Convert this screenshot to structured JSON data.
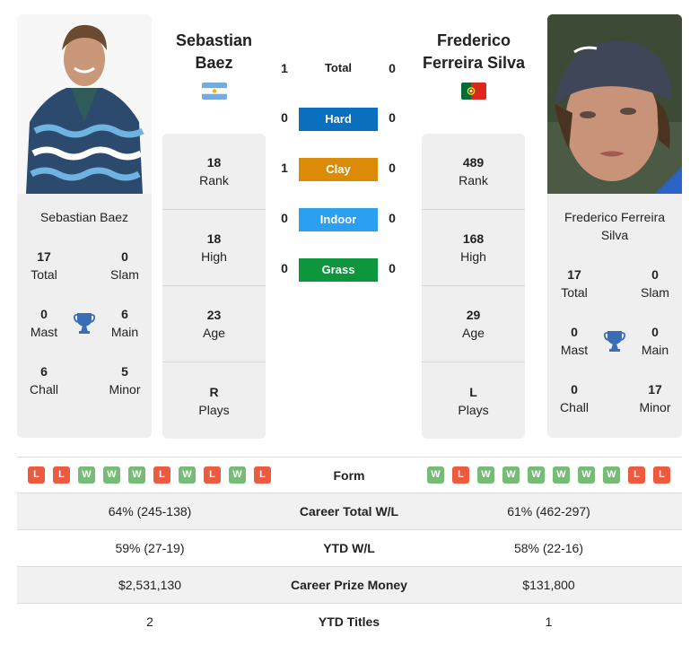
{
  "player1": {
    "name": "Sebastian Baez",
    "name_line1": "Sebastian",
    "name_line2": "Baez",
    "country": "Argentina",
    "flag_icon": "argentina-flag-icon",
    "titles": {
      "total": {
        "value": "17",
        "label": "Total"
      },
      "slam": {
        "value": "0",
        "label": "Slam"
      },
      "mast": {
        "value": "0",
        "label": "Mast"
      },
      "main": {
        "value": "6",
        "label": "Main"
      },
      "chall": {
        "value": "6",
        "label": "Chall"
      },
      "minor": {
        "value": "5",
        "label": "Minor"
      }
    },
    "stats": [
      {
        "value": "18",
        "label": "Rank"
      },
      {
        "value": "18",
        "label": "High"
      },
      {
        "value": "23",
        "label": "Age"
      },
      {
        "value": "R",
        "label": "Plays"
      }
    ],
    "form": [
      "L",
      "L",
      "W",
      "W",
      "W",
      "L",
      "W",
      "L",
      "W",
      "L"
    ]
  },
  "player2": {
    "name": "Frederico Ferreira Silva",
    "name_line1": "Frederico",
    "name_line2": "Ferreira Silva",
    "card_name_line1": "Frederico Ferreira",
    "card_name_line2": "Silva",
    "country": "Portugal",
    "flag_icon": "portugal-flag-icon",
    "titles": {
      "total": {
        "value": "17",
        "label": "Total"
      },
      "slam": {
        "value": "0",
        "label": "Slam"
      },
      "mast": {
        "value": "0",
        "label": "Mast"
      },
      "main": {
        "value": "0",
        "label": "Main"
      },
      "chall": {
        "value": "0",
        "label": "Chall"
      },
      "minor": {
        "value": "17",
        "label": "Minor"
      }
    },
    "stats": [
      {
        "value": "489",
        "label": "Rank"
      },
      {
        "value": "168",
        "label": "High"
      },
      {
        "value": "29",
        "label": "Age"
      },
      {
        "value": "L",
        "label": "Plays"
      }
    ],
    "form": [
      "W",
      "L",
      "W",
      "W",
      "W",
      "W",
      "W",
      "W",
      "L",
      "L"
    ]
  },
  "h2h": [
    {
      "label": "Total",
      "p1": "1",
      "p2": "0",
      "color": ""
    },
    {
      "label": "Hard",
      "p1": "0",
      "p2": "0",
      "color": "#0b6fc0"
    },
    {
      "label": "Clay",
      "p1": "1",
      "p2": "0",
      "color": "#dc8b06"
    },
    {
      "label": "Indoor",
      "p1": "0",
      "p2": "0",
      "color": "#2b9ff0"
    },
    {
      "label": "Grass",
      "p1": "0",
      "p2": "0",
      "color": "#0d963c"
    }
  ],
  "form_label": "Form",
  "comparison": [
    {
      "label": "Career Total W/L",
      "p1": "64% (245-138)",
      "p2": "61% (462-297)"
    },
    {
      "label": "YTD W/L",
      "p1": "59% (27-19)",
      "p2": "58% (22-16)"
    },
    {
      "label": "Career Prize Money",
      "p1": "$2,531,130",
      "p2": "$131,800"
    },
    {
      "label": "YTD Titles",
      "p1": "2",
      "p2": "1"
    }
  ],
  "colors": {
    "win": "#76bb76",
    "loss": "#ee5a3f",
    "trophy": "#3a6db5",
    "card_bg": "#efefef"
  }
}
